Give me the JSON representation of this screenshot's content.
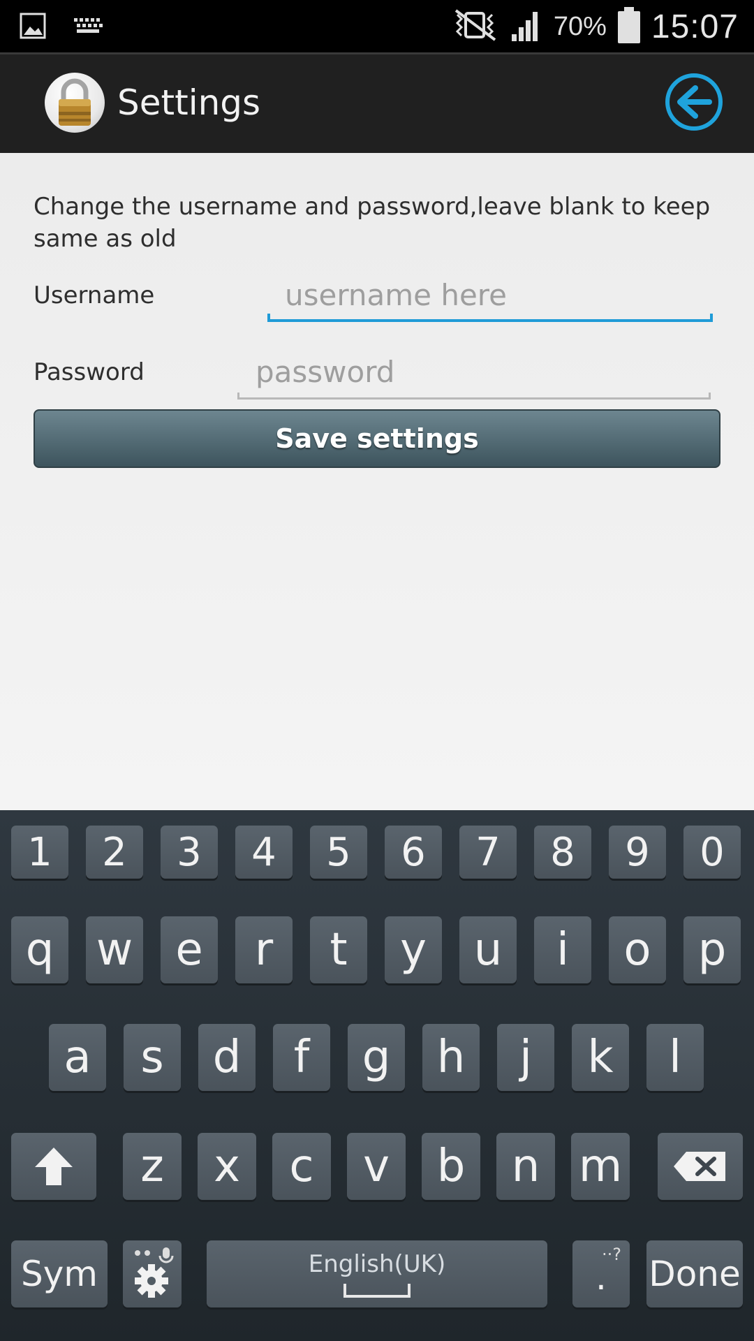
{
  "status_bar": {
    "left_icons": [
      "gallery-icon",
      "keyboard-icon"
    ],
    "right_icons": [
      "vibrate-icon",
      "signal-icon",
      "battery-icon"
    ],
    "battery": "70%",
    "clock": "15:07"
  },
  "app_bar": {
    "title": "Settings",
    "icon": "lock-icon",
    "back_icon": "back-arrow-icon",
    "accent": "#1f9bd7"
  },
  "form": {
    "description": "Change the username and password,leave blank to keep same as old",
    "username_label": "Username",
    "username_placeholder": "username here",
    "username_value": "",
    "password_label": "Password",
    "password_placeholder": "password",
    "password_value": "",
    "save_label": "Save settings"
  },
  "keyboard": {
    "numbers": [
      "1",
      "2",
      "3",
      "4",
      "5",
      "6",
      "7",
      "8",
      "9",
      "0"
    ],
    "row1": [
      "q",
      "w",
      "e",
      "r",
      "t",
      "y",
      "u",
      "i",
      "o",
      "p"
    ],
    "row2": [
      "a",
      "s",
      "d",
      "f",
      "g",
      "h",
      "j",
      "k",
      "l"
    ],
    "row3": [
      "z",
      "x",
      "c",
      "v",
      "b",
      "n",
      "m"
    ],
    "sym_label": "Sym",
    "language_label": "English(UK)",
    "period_label": ".",
    "done_label": "Done"
  }
}
